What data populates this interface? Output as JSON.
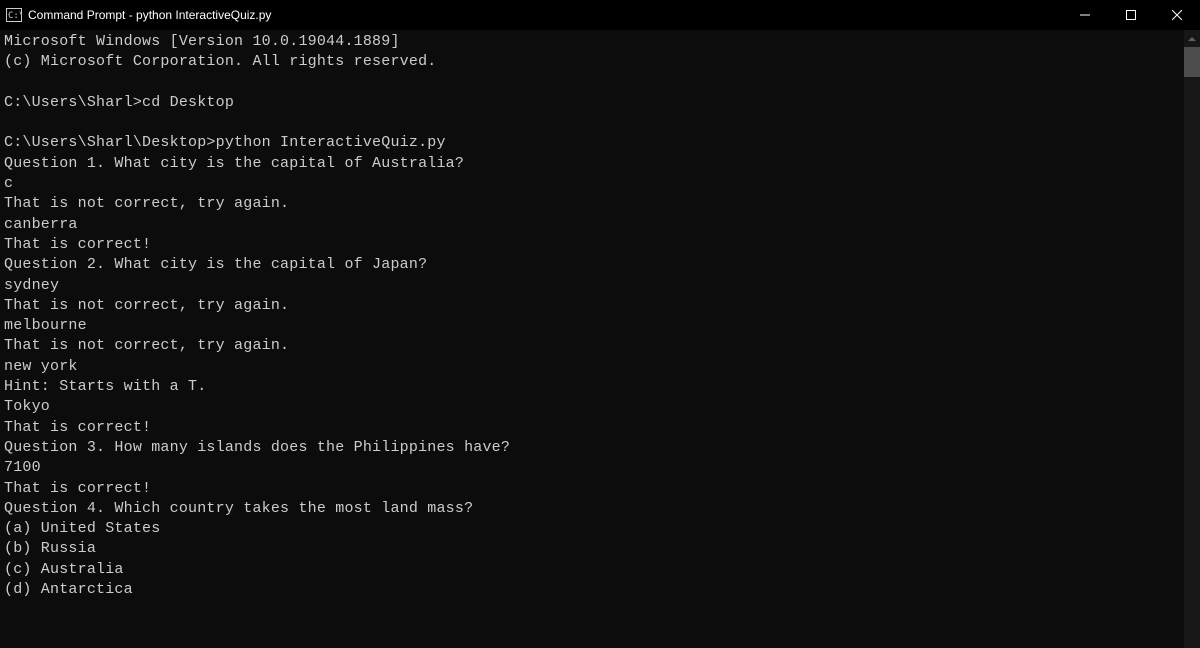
{
  "titlebar": {
    "title": "Command Prompt - python  InteractiveQuiz.py"
  },
  "lines": [
    "Microsoft Windows [Version 10.0.19044.1889]",
    "(c) Microsoft Corporation. All rights reserved.",
    "",
    "C:\\Users\\Sharl>cd Desktop",
    "",
    "C:\\Users\\Sharl\\Desktop>python InteractiveQuiz.py",
    "Question 1. What city is the capital of Australia?",
    "c",
    "That is not correct, try again.",
    "canberra",
    "That is correct!",
    "Question 2. What city is the capital of Japan?",
    "sydney",
    "That is not correct, try again.",
    "melbourne",
    "That is not correct, try again.",
    "new york",
    "Hint: Starts with a T.",
    "Tokyo",
    "That is correct!",
    "Question 3. How many islands does the Philippines have?",
    "7100",
    "That is correct!",
    "Question 4. Which country takes the most land mass?",
    "(a) United States",
    "(b) Russia",
    "(c) Australia",
    "(d) Antarctica"
  ]
}
